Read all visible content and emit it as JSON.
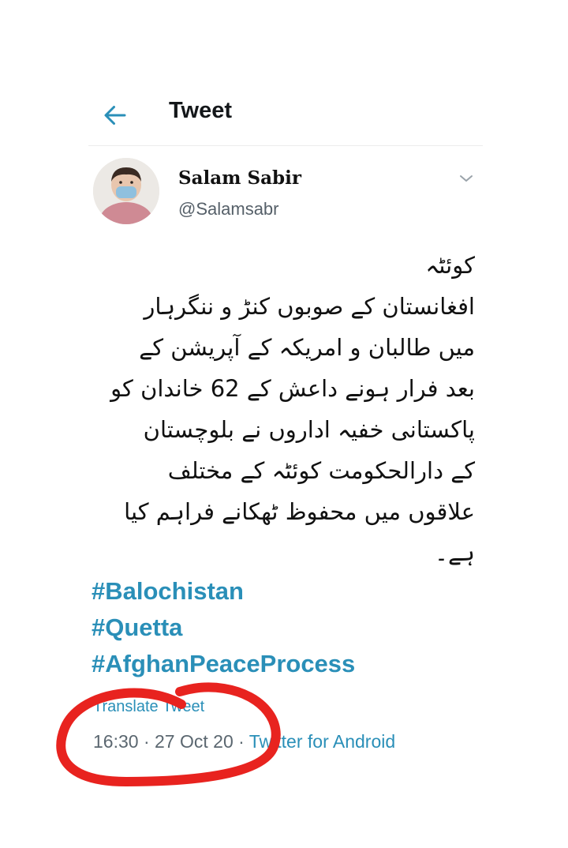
{
  "header": {
    "title": "Tweet"
  },
  "author": {
    "name": "Salam Sabir",
    "handle": "@Salamsabr"
  },
  "tweet": {
    "lines": [
      "کوئٹہ",
      "افغانستان کے صوبوں کنڑ و ننگرہار",
      "میں طالبان و امریکہ کے آپریشن کے",
      "بعد فرار ہونے داعش کے 62 خاندان کو",
      "پاکستانی خفیہ اداروں نے  بلوچستان",
      "کے دارالحکومت کوئٹہ کے مختلف",
      "علاقوں میں محفوظ ٹھکانے فراہم کیا",
      "ہے۔"
    ],
    "hashtags": [
      "#Balochistan",
      "#Quetta",
      "#AfghanPeaceProcess"
    ],
    "translate_label": "Translate Tweet",
    "time": "16:30",
    "date": "27 Oct 20",
    "source": "Twitter for Android"
  },
  "colors": {
    "accent": "#2a8fb8",
    "annotation": "#e8231f"
  }
}
